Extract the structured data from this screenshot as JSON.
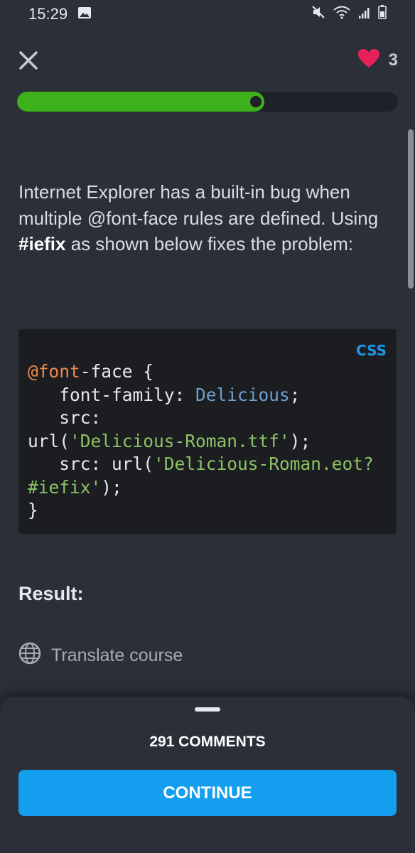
{
  "status_bar": {
    "time": "15:29",
    "icons": [
      "image-icon",
      "mute-icon",
      "wifi-icon",
      "signal-icon",
      "battery-icon"
    ]
  },
  "header": {
    "close_icon": "close-icon",
    "heart_icon": "heart-icon",
    "hearts_count": "3",
    "progress_fraction": 0.649
  },
  "content": {
    "intro_part1": "Internet Explorer has a built-in bug when multiple @font-face rules are defined. Using ",
    "intro_bold": "#iefix",
    "intro_part2": " as shown below fixes the problem:",
    "code": {
      "language": "CSS",
      "line1_at": "@font",
      "line1_rest": "-face {",
      "line2_prop": "   font-family: ",
      "line2_val": "Delicious",
      "line2_end": ";",
      "line3": "   src:",
      "line4_pre": "url(",
      "line4_str": "'Delicious-Roman.ttf'",
      "line4_end": ");",
      "line5_pre": "   src: url(",
      "line5_str": "'Delicious-Roman.eot?",
      "line6_str": "#iefix'",
      "line6_end": ");",
      "line7": "}"
    },
    "result_label": "Result:",
    "translate_label": "Translate course",
    "translate_icon": "globe-icon"
  },
  "bottom_sheet": {
    "comments_label": "291 COMMENTS",
    "continue_label": "CONTINUE"
  },
  "colors": {
    "background": "#2b2f38",
    "progress": "#3cb11c",
    "heart": "#e8205a",
    "button": "#149ef0",
    "code_background": "#1b1d21",
    "code_keyword": "#f08a4b",
    "code_value": "#6f9fcf",
    "code_string": "#8cc265"
  }
}
